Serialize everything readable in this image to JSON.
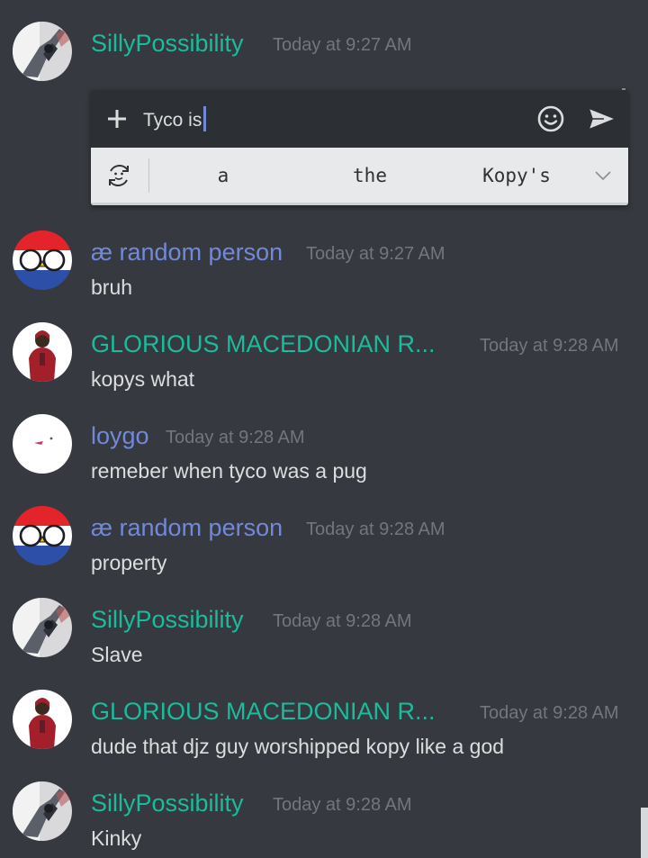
{
  "composer": {
    "plus_icon": "plus-icon",
    "text": "Tyco is",
    "emoji_icon": "smile-icon",
    "send_icon": "send-icon",
    "suggestions": [
      "a",
      "the",
      "Kopy's"
    ],
    "refresh_icon": "refresh-icon",
    "chevron_icon": "chevron-down-icon"
  },
  "messages": [
    {
      "username": "SillyPossibility",
      "timestamp": "Today at 9:27 AM",
      "text": "",
      "name_color": "#1abc9c",
      "avatar": "silly"
    },
    {
      "username": "æ random person",
      "timestamp": "Today at 9:27 AM",
      "text": "bruh",
      "name_color": "#7289da",
      "avatar": "ball"
    },
    {
      "username": "GLORIOUS MACEDONIAN R...",
      "timestamp": "Today at 9:28 AM",
      "text": "kopys what",
      "name_color": "#1abc9c",
      "avatar": "person"
    },
    {
      "username": "loygo",
      "timestamp": "Today at 9:28 AM",
      "text": "remeber when tyco was a pug",
      "name_color": "#7289da",
      "avatar": "white"
    },
    {
      "username": "æ random person",
      "timestamp": "Today at 9:28 AM",
      "text": "property",
      "name_color": "#7289da",
      "avatar": "ball"
    },
    {
      "username": "SillyPossibility",
      "timestamp": "Today at 9:28 AM",
      "text": "Slave",
      "name_color": "#1abc9c",
      "avatar": "silly"
    },
    {
      "username": "GLORIOUS MACEDONIAN R...",
      "timestamp": "Today at 9:28 AM",
      "text": "dude that djz guy worshipped kopy like a god",
      "name_color": "#1abc9c",
      "avatar": "person"
    },
    {
      "username": "SillyPossibility",
      "timestamp": "Today at 9:28 AM",
      "text": "Kinky",
      "name_color": "#1abc9c",
      "avatar": "silly"
    }
  ],
  "colors": {
    "background": "#36393f",
    "teal_name": "#1abc9c",
    "blurple_name": "#7289da",
    "timestamp": "#72767d",
    "message_text": "#dcddde"
  }
}
